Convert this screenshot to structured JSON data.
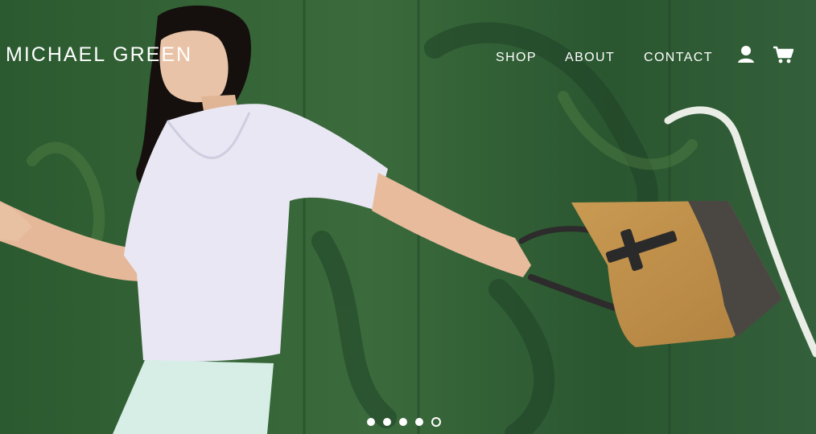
{
  "header": {
    "logo_text": "MICHAEL GREEN",
    "nav": [
      {
        "label": "SHOP"
      },
      {
        "label": "ABOUT"
      },
      {
        "label": "CONTACT"
      }
    ],
    "icons": [
      "account-icon",
      "cart-icon"
    ]
  },
  "slider": {
    "slide_count": 5,
    "active_index": 4
  },
  "colors": {
    "background_green": "#2f5a32",
    "text": "#ffffff"
  }
}
